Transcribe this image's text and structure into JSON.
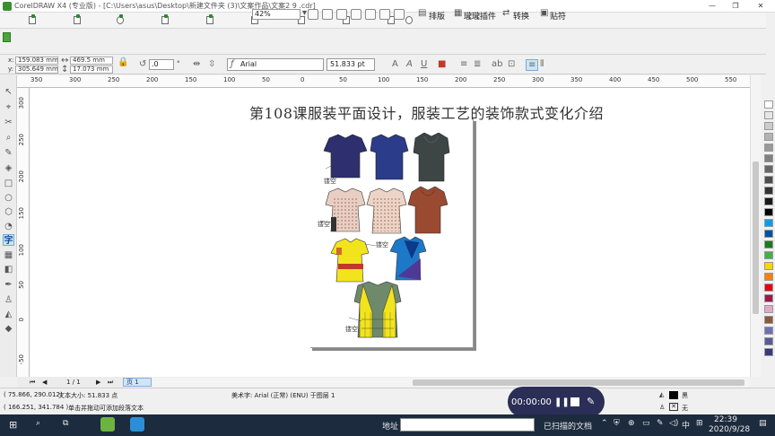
{
  "window": {
    "title": "CorelDRAW X4 (专业版) - [C:\\Users\\asus\\Desktop\\新建文件夹 (3)\\文案作品\\文案2 9 .cdr]"
  },
  "standard_toolbar": {
    "zoom_value": "42%",
    "typeset_label": "排版",
    "plugin_label": "瓏瓏插件",
    "convert_label": "转换",
    "paste_label": "贴符"
  },
  "property_bar": {
    "x_label": "x:",
    "y_label": "y:",
    "x_value": "159.083 mm",
    "y_value": "305.649 mm",
    "w_value": "469.5 mm",
    "h_value": "17.073 mm",
    "rotation_value": ".0",
    "degree_symbol": "°",
    "font_name": "Arial",
    "font_size": "51.833 pt"
  },
  "ruler": {
    "h_ticks": [
      "350",
      "300",
      "250",
      "200",
      "150",
      "100",
      "50",
      "0",
      "50",
      "100",
      "150",
      "200",
      "250",
      "300",
      "350",
      "400",
      "450",
      "500",
      "550"
    ],
    "v_ticks": [
      "300",
      "250",
      "200",
      "150",
      "100",
      "50",
      "0",
      "-50"
    ]
  },
  "document": {
    "heading": "第108课服装平面设计，服装工艺的装饰款式变化介绍",
    "captions": [
      "镂空",
      "镂空",
      "镂空",
      "镂空"
    ]
  },
  "page_nav": {
    "page_count": "1 / 1",
    "page_tab": "页 1"
  },
  "status": {
    "coords": "( 75.866, 290.012)",
    "text_size": "文本大小: 51.833 点",
    "font_desc": "美术字: Arial (正常) (ENU) 于图层 1",
    "coords2": "( 166.251, 341.784 )",
    "hint": "单击并拖动可添加段落文本",
    "fill_label": "黑",
    "outline_label": "无"
  },
  "recording": {
    "time": "00:00:00"
  },
  "taskbar": {
    "address_label": "地址",
    "scanned_label": "已扫描的文档",
    "ime_label": "中",
    "time": "22:39",
    "date": "2020/9/28"
  },
  "palette_colors": [
    "#ffffff",
    "#e6e6e6",
    "#cccccc",
    "#b3b3b3",
    "#999999",
    "#808080",
    "#666666",
    "#4d4d4d",
    "#333333",
    "#1a1a1a",
    "#000000",
    "#00a0e9",
    "#0050a0",
    "#1e7a1e",
    "#44b044",
    "#ffd200",
    "#ff7f00",
    "#e60012",
    "#a0184a",
    "#e6a8c8",
    "#8a5a3a",
    "#7070b0",
    "#5a5a9a",
    "#3a3a7a"
  ],
  "colors": {
    "accent_blue": "#cde3f7",
    "taskbar": "#1c2b3d",
    "recording_bg": "#2b2f57"
  }
}
